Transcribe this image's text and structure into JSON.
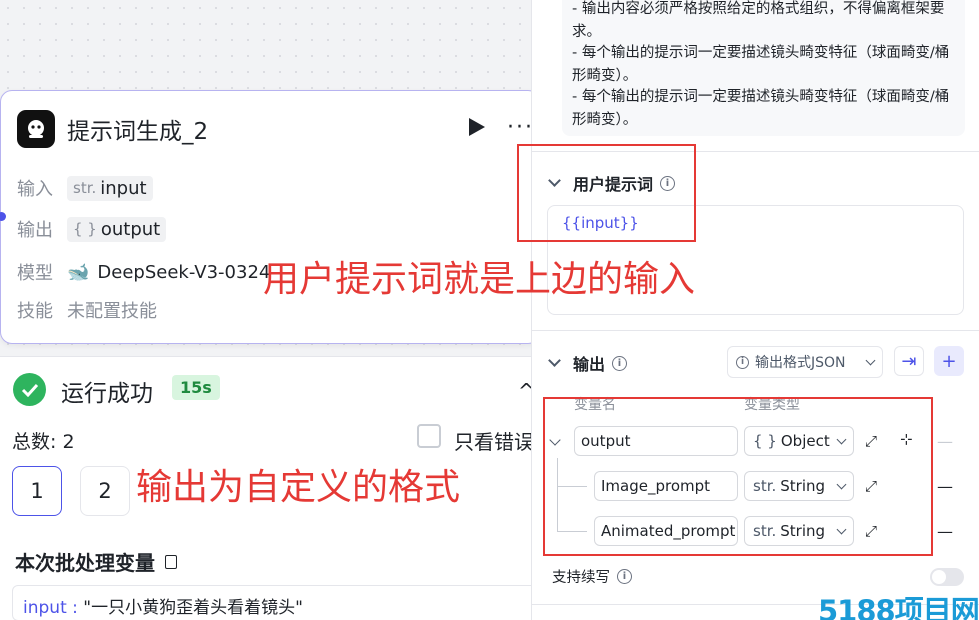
{
  "node": {
    "title": "提示词生成_2",
    "input_label": "输入",
    "input_type": "str.",
    "input_name": "input",
    "output_label": "输出",
    "output_type": "{ }",
    "output_name": "output",
    "model_label": "模型",
    "model_name": "DeepSeek-V3-0324",
    "skill_label": "技能",
    "skill_value": "未配置技能"
  },
  "result": {
    "status": "运行成功",
    "duration": "15s",
    "total": "总数: 2",
    "only_errors": "只看错误",
    "pages": [
      "1",
      "2"
    ],
    "batch_title": "本次批处理变量",
    "batch_key": "input :",
    "batch_value": "\"一只小黄狗歪着头看着镜头\""
  },
  "panel": {
    "system_lines": [
      "- 输出内容必须严格按照给定的格式组织，不得偏离框架要求。",
      "- 每个输出的提示词一定要描述镜头畸变特征（球面畸变/桶形畸变）。",
      "- 每个输出的提示词一定要描述镜头畸变特征（球面畸变/桶形畸变）。"
    ],
    "user_prompt_title": "用户提示词",
    "user_prompt_value": "{{input}}",
    "output_title": "输出",
    "format_select": "输出格式JSON",
    "col_var_name": "变量名",
    "col_var_type": "变量类型",
    "vars": [
      {
        "name": "output",
        "type_prefix": "{ }",
        "type": "Object"
      },
      {
        "name": "Image_prompt",
        "type_prefix": "str.",
        "type": "String"
      },
      {
        "name": "Animated_prompt",
        "type_prefix": "str.",
        "type": "String"
      }
    ],
    "support_continue": "支持续写"
  },
  "annotations": {
    "user_prompt_note": "用户提示词就是上边的输入",
    "output_note": "输出为自定义的格式"
  },
  "watermark": "5188项目网",
  "colors": {
    "accent": "#4d53e8",
    "success": "#2eb45e",
    "annotation": "#e53935"
  }
}
